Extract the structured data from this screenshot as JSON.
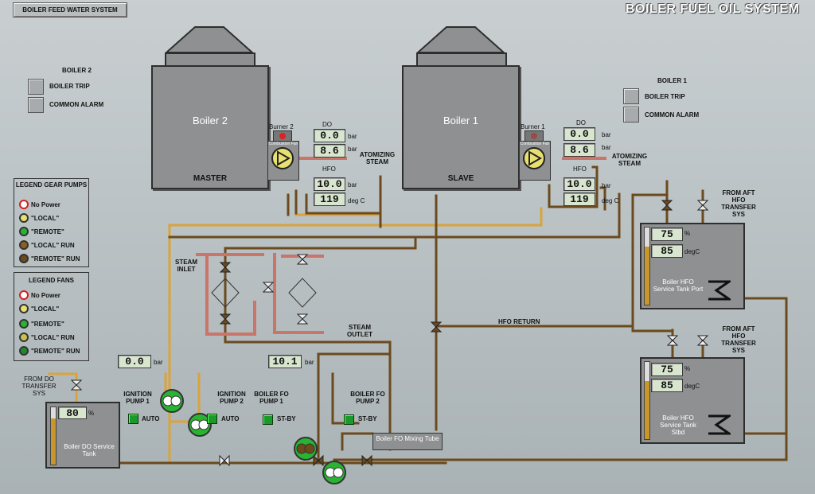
{
  "nav": {
    "boiler_feed_water_button": "BOILER FEED WATER SYSTEM"
  },
  "title": "BOILER FUEL OIL SYSTEM",
  "boiler2_panel": {
    "header": "BOILER 2",
    "trip": "BOILER TRIP",
    "alarm": "COMMON ALARM"
  },
  "boiler1_panel": {
    "header": "BOILER 1",
    "trip": "BOILER TRIP",
    "alarm": "COMMON ALARM"
  },
  "boiler2": {
    "name": "Boiler 2",
    "role": "MASTER",
    "burner": "Burner 2",
    "fan": "Combustion Fan",
    "do_label": "DO",
    "do_bar": "0.0",
    "atom_bar": "8.6",
    "atom_label": "ATOMIZING STEAM",
    "hfo_label": "HFO",
    "hfo_bar": "10.0",
    "hfo_temp": "119",
    "unit_bar": "bar",
    "unit_temp": "deg C"
  },
  "boiler1": {
    "name": "Boiler 1",
    "role": "SLAVE",
    "burner": "Burner 1",
    "fan": "Combustion Fan",
    "do_label": "DO",
    "do_bar": "0.0",
    "atom_bar": "8.6",
    "atom_label": "ATOMIZING STEAM",
    "hfo_label": "HFO",
    "hfo_bar": "10.0",
    "hfo_temp": "119",
    "unit_bar": "bar",
    "unit_temp": "deg C"
  },
  "legend_pumps": {
    "title": "LEGEND GEAR PUMPS",
    "items": [
      "No Power",
      "\"LOCAL\"",
      "\"REMOTE\"",
      "\"LOCAL\" RUN",
      "\"REMOTE\" RUN"
    ]
  },
  "legend_fans": {
    "title": "LEGEND FANS",
    "items": [
      "No Power",
      "\"LOCAL\"",
      "\"REMOTE\"",
      "\"LOCAL\" RUN",
      "\"REMOTE\" RUN"
    ]
  },
  "steam": {
    "inlet": "STEAM INLET",
    "outlet": "STEAM OUTLET"
  },
  "hfo_return": "HFO RETURN",
  "ignition": {
    "pressure": "0.0",
    "unit": "bar",
    "pump1": "IGNITION PUMP 1",
    "pump2": "IGNITION PUMP 2",
    "mode": "AUTO"
  },
  "fo_pumps": {
    "pressure": "10.1",
    "unit": "bar",
    "pump1": "BOILER FO PUMP 1",
    "pump2": "BOILER FO PUMP 2",
    "mode": "ST-BY"
  },
  "mixing_tube": "Boiler FO Mixing Tube",
  "do_tank": {
    "from": "FROM DO TRANSFER SYS",
    "level": "80",
    "unit": "%",
    "name": "Boiler DO Service Tank",
    "level_fraction": 0.8
  },
  "port_tank": {
    "from": "FROM AFT HFO TRANSFER SYS",
    "level": "75",
    "temp": "85",
    "unit_level": "%",
    "unit_temp": "degC",
    "name": "Boiler HFO Service Tank Port",
    "level_fraction": 0.75
  },
  "stbd_tank": {
    "from": "FROM AFT HFO TRANSFER SYS",
    "level": "75",
    "temp": "85",
    "unit_level": "%",
    "unit_temp": "degC",
    "name": "Boiler HFO Service Tank Stbd",
    "level_fraction": 0.75
  },
  "colors": {
    "hfo": "#6b4a1e",
    "do": "#d9a43a",
    "steam": "#c9756a",
    "run": "#28b432"
  }
}
